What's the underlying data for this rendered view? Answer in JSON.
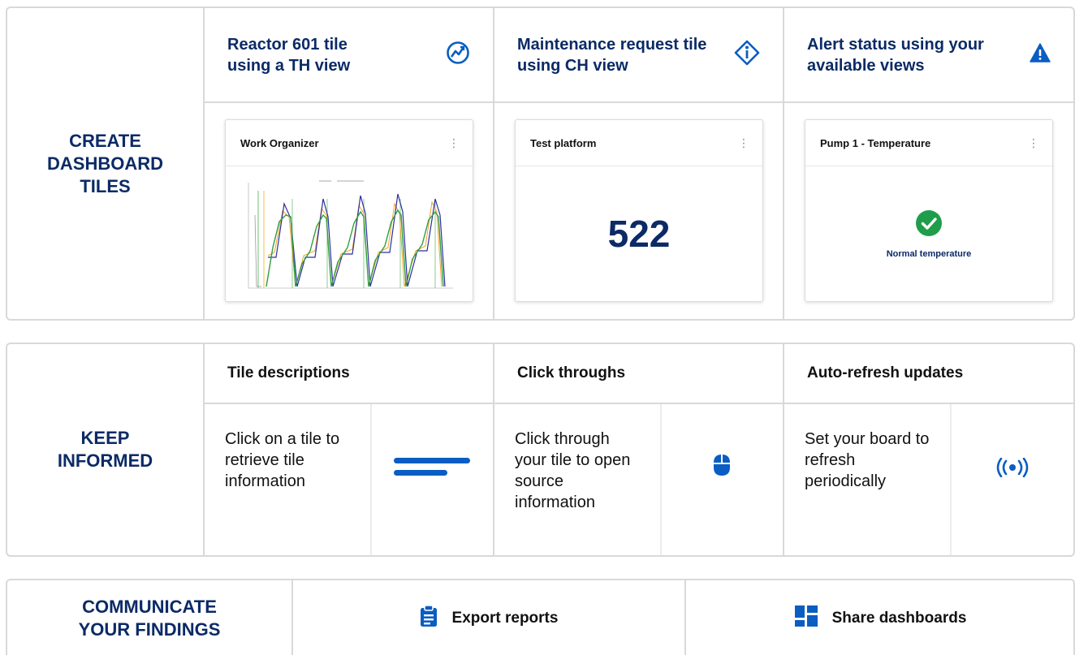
{
  "create": {
    "section_label": "CREATE DASHBOARD TILES",
    "columns": [
      {
        "title": "Reactor 601 tile using a TH view",
        "icon": "trend-icon",
        "tile_title": "Work Organizer"
      },
      {
        "title": "Maintenance request tile using CH view",
        "icon": "info-icon",
        "tile_title": "Test platform",
        "value": "522"
      },
      {
        "title": "Alert status using your available views",
        "icon": "warning-icon",
        "tile_title": "Pump 1 - Temperature",
        "status_text": "Normal temperature"
      }
    ]
  },
  "informed": {
    "section_label": "KEEP INFORMED",
    "columns": [
      {
        "title": "Tile descriptions",
        "text": "Click on a tile to retrieve tile information",
        "icon": "description-lines-icon"
      },
      {
        "title": "Click throughs",
        "text": "Click through your tile to open source information",
        "icon": "mouse-icon"
      },
      {
        "title": "Auto-refresh updates",
        "text": "Set your board to refresh periodically",
        "icon": "broadcast-icon"
      }
    ]
  },
  "communicate": {
    "section_label": "COMMUNICATE YOUR FINDINGS",
    "items": [
      {
        "label": "Export reports",
        "icon": "clipboard-icon"
      },
      {
        "label": "Share dashboards",
        "icon": "dashboard-icon"
      }
    ]
  },
  "colors": {
    "brand_navy": "#0b2a66",
    "accent_blue": "#0a5dc2",
    "ok_green": "#1e9e4a"
  }
}
